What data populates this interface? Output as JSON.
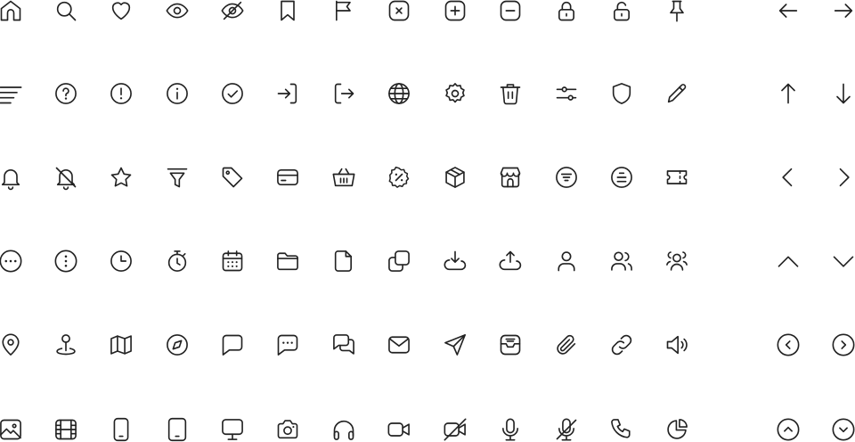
{
  "stroke_color": "#222222",
  "background_color": "#ffffff",
  "rows": [
    [
      "home-icon",
      "search-icon",
      "heart-icon",
      "eye-icon",
      "eye-off-icon",
      "bookmark-icon",
      "flag-icon",
      "close-square-icon",
      "plus-square-icon",
      "minus-square-icon",
      "lock-icon",
      "unlock-icon",
      "pin-icon",
      "arrow-left-icon",
      "arrow-right-icon"
    ],
    [
      "menu-icon",
      "help-circle-icon",
      "alert-circle-icon",
      "info-circle-icon",
      "check-circle-icon",
      "login-icon",
      "logout-icon",
      "globe-icon",
      "settings-icon",
      "trash-icon",
      "sliders-icon",
      "shield-icon",
      "pencil-icon",
      "arrow-up-icon",
      "arrow-down-icon"
    ],
    [
      "bell-icon",
      "bell-off-icon",
      "star-icon",
      "filter-icon",
      "tag-icon",
      "credit-card-icon",
      "basket-icon",
      "discount-badge-icon",
      "box-icon",
      "store-icon",
      "filter-circle-icon",
      "list-circle-icon",
      "ticket-icon",
      "chevron-left-icon",
      "chevron-right-icon"
    ],
    [
      "more-horizontal-icon",
      "more-vertical-icon",
      "clock-icon",
      "stopwatch-icon",
      "calendar-icon",
      "folder-icon",
      "file-icon",
      "copy-icon",
      "download-cloud-icon",
      "upload-cloud-icon",
      "user-icon",
      "users-icon",
      "user-group-icon",
      "chevron-up-icon",
      "chevron-down-icon"
    ],
    [
      "map-pin-icon",
      "location-marker-icon",
      "map-icon",
      "compass-icon",
      "chat-icon",
      "chat-dots-icon",
      "chats-icon",
      "mail-icon",
      "send-icon",
      "inbox-icon",
      "paperclip-icon",
      "link-icon",
      "volume-icon",
      "chevron-left-circle-icon",
      "chevron-right-circle-icon"
    ],
    [
      "image-icon",
      "film-icon",
      "smartphone-icon",
      "tablet-icon",
      "monitor-icon",
      "camera-icon",
      "headphones-icon",
      "video-icon",
      "video-off-icon",
      "mic-icon",
      "mic-off-icon",
      "phone-icon",
      "pie-chart-icon",
      "chevron-up-circle-icon",
      "chevron-down-circle-icon"
    ]
  ]
}
